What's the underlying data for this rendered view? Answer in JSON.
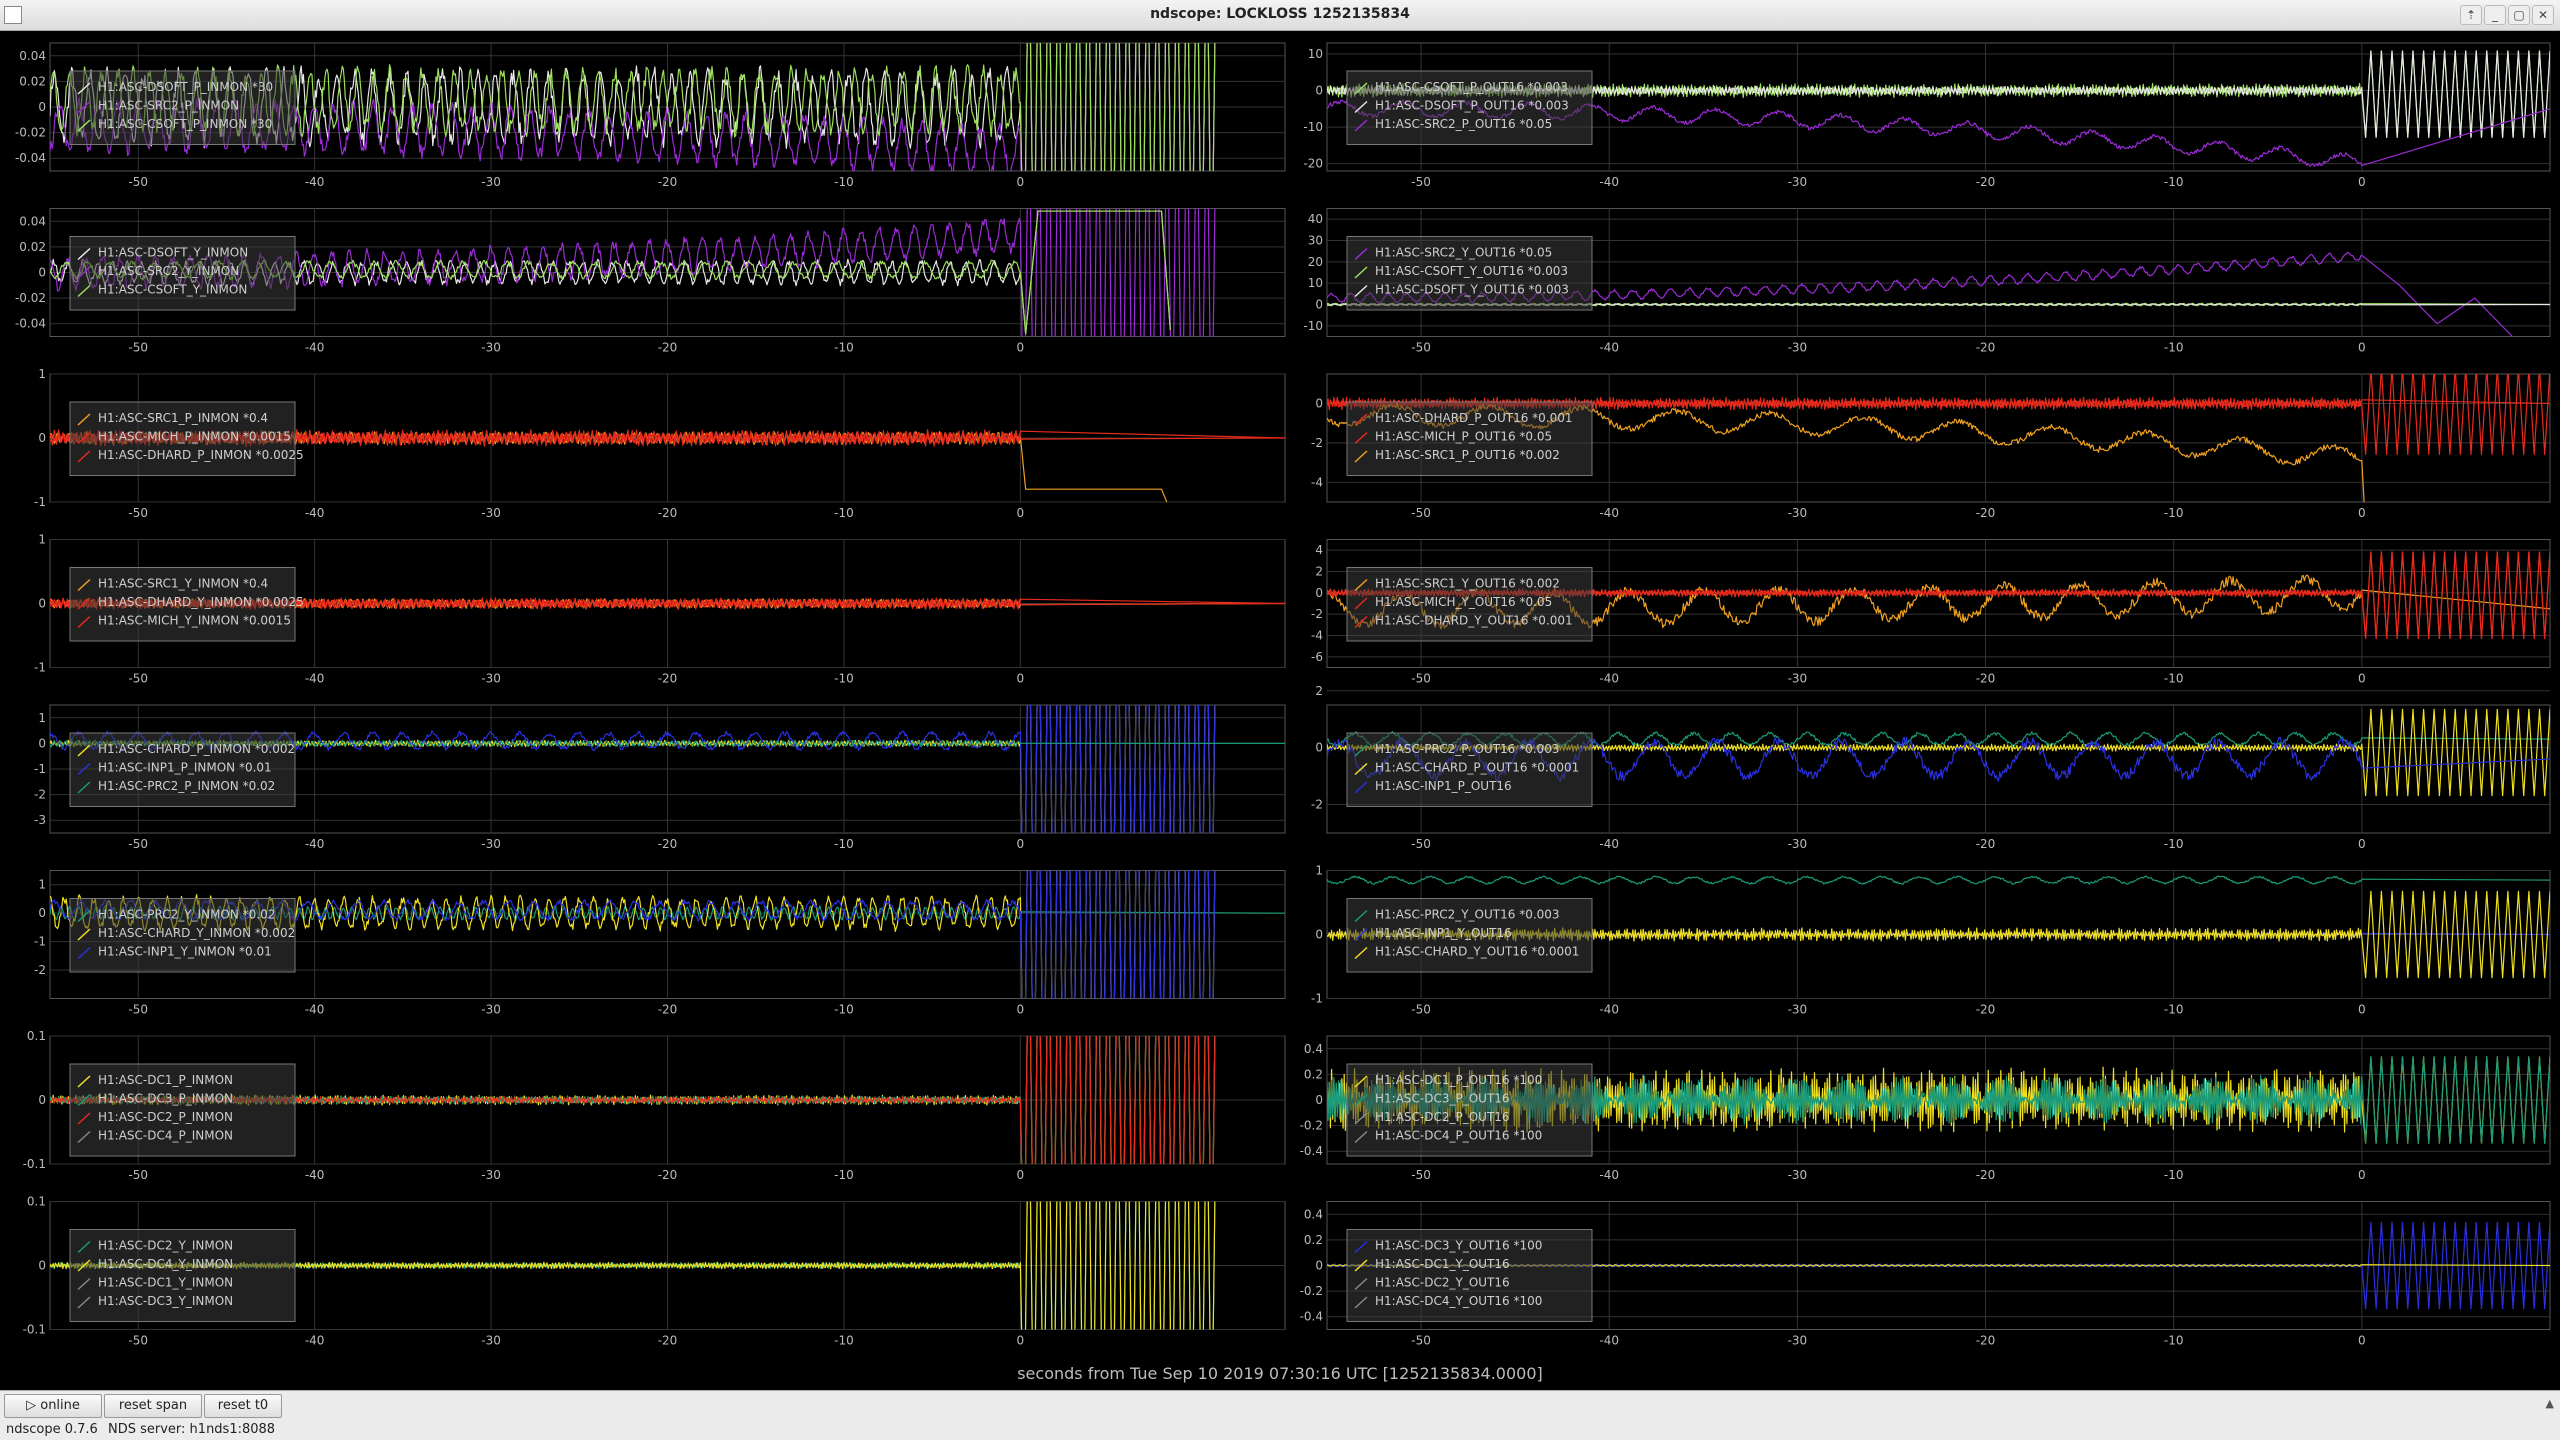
{
  "window": {
    "title": "ndscope: LOCKLOSS 1252135834",
    "controls": [
      "⇡",
      "_",
      "▢",
      "✕"
    ]
  },
  "x_caption": "seconds from Tue Sep 10 2019 07:30:16 UTC [1252135834.0000]",
  "toolbar": {
    "online_label": "online",
    "reset_span_label": "reset span",
    "reset_t0_label": "reset t0"
  },
  "status": {
    "version": "ndscope 0.7.6",
    "server": "NDS server: h1nds1:8088"
  },
  "colors": {
    "background": "#000000",
    "grid": "#333333",
    "axis_text": "#bbbbbb",
    "purple": "#9a2bd6",
    "green": "#9ce05a",
    "white": "#e8e8e8",
    "red": "#e82a1c",
    "orange": "#f0a020",
    "blue": "#2a30e0",
    "yellow": "#f0e020",
    "teal": "#1a9a78"
  },
  "chart_data": [
    {
      "type": "line",
      "xlim": [
        -55,
        15
      ],
      "xticks": [
        -50,
        -40,
        -30,
        -20,
        -10,
        0
      ],
      "ylim": [
        -0.05,
        0.05
      ],
      "yticks": [
        "0.04",
        "0.02",
        "0",
        "-0.02",
        "-0.04"
      ],
      "grid": true,
      "legend_position": "top-left",
      "legend": [
        "H1:ASC-DSOFT_P_INMON *30",
        "H1:ASC-SRC2_P_INMON",
        "H1:ASC-CSOFT_P_INMON *30"
      ],
      "series": [
        {
          "name": "H1:ASC-DSOFT_P_INMON *30",
          "color": "#e8e8e8",
          "base": 0.0,
          "amp": 0.025,
          "freq": 1.0,
          "post": "rail"
        },
        {
          "name": "H1:ASC-SRC2_P_INMON",
          "color": "#9a2bd6",
          "base": -0.015,
          "amp": 0.018,
          "freq": 0.9,
          "drift": -0.02,
          "post": "rail"
        },
        {
          "name": "H1:ASC-CSOFT_P_INMON *30",
          "color": "#9ce05a",
          "base": 0.005,
          "amp": 0.022,
          "freq": 1.1,
          "post": "rail"
        }
      ]
    },
    {
      "type": "line",
      "xlim": [
        -55,
        10
      ],
      "xticks": [
        -50,
        -40,
        -30,
        -20,
        -10,
        0
      ],
      "ylim": [
        -22,
        13
      ],
      "yticks": [
        "10",
        "0",
        "-10",
        "-20"
      ],
      "grid": true,
      "legend_position": "top-left",
      "legend": [
        "H1:ASC-CSOFT_P_OUT16 *0.003",
        "H1:ASC-DSOFT_P_OUT16 *0.003",
        "H1:ASC-SRC2_P_OUT16 *0.05"
      ],
      "series": [
        {
          "name": "H1:ASC-CSOFT_P_OUT16 *0.003",
          "color": "#9ce05a",
          "base": 0.0,
          "amp": 1.5,
          "freq": 6.0,
          "post": "burst"
        },
        {
          "name": "H1:ASC-DSOFT_P_OUT16 *0.003",
          "color": "#e8e8e8",
          "base": 0.0,
          "amp": 1.0,
          "freq": 5.0,
          "post": "burst"
        },
        {
          "name": "H1:ASC-SRC2_P_OUT16 *0.05",
          "color": "#9a2bd6",
          "base": -5,
          "amp": 2,
          "freq": 0.3,
          "drift": -15,
          "post": "flat"
        }
      ]
    },
    {
      "type": "line",
      "xlim": [
        -55,
        15
      ],
      "xticks": [
        -50,
        -40,
        -30,
        -20,
        -10,
        0
      ],
      "ylim": [
        -0.05,
        0.05
      ],
      "yticks": [
        "0.04",
        "0.02",
        "0",
        "-0.02",
        "-0.04"
      ],
      "grid": true,
      "legend_position": "top-left",
      "legend": [
        "H1:ASC-DSOFT_Y_INMON",
        "H1:ASC-SRC2_Y_INMON",
        "H1:ASC-CSOFT_Y_INMON"
      ],
      "series": [
        {
          "name": "H1:ASC-DSOFT_Y_INMON",
          "color": "#e8e8e8",
          "base": 0.0,
          "amp": 0.008,
          "freq": 1.2,
          "post": "box"
        },
        {
          "name": "H1:ASC-SRC2_Y_INMON",
          "color": "#9a2bd6",
          "base": 0.0,
          "amp": 0.012,
          "freq": 1.0,
          "drift": 0.03,
          "post": "rail"
        },
        {
          "name": "H1:ASC-CSOFT_Y_INMON",
          "color": "#9ce05a",
          "base": 0.002,
          "amp": 0.006,
          "freq": 0.8,
          "post": "box"
        }
      ]
    },
    {
      "type": "line",
      "xlim": [
        -55,
        10
      ],
      "xticks": [
        -50,
        -40,
        -30,
        -20,
        -10,
        0
      ],
      "ylim": [
        -15,
        45
      ],
      "yticks": [
        "40",
        "30",
        "20",
        "10",
        "0",
        "-10"
      ],
      "grid": true,
      "legend_position": "top-left",
      "legend": [
        "H1:ASC-SRC2_Y_OUT16 *0.05",
        "H1:ASC-CSOFT_Y_OUT16 *0.003",
        "H1:ASC-DSOFT_Y_OUT16 *0.003"
      ],
      "series": [
        {
          "name": "H1:ASC-SRC2_Y_OUT16 *0.05",
          "color": "#9a2bd6",
          "base": 3,
          "amp": 2,
          "freq": 1.0,
          "drift": 20,
          "post": "dip"
        },
        {
          "name": "H1:ASC-CSOFT_Y_OUT16 *0.003",
          "color": "#9ce05a",
          "base": 0,
          "amp": 0.5,
          "freq": 2,
          "post": "flat"
        },
        {
          "name": "H1:ASC-DSOFT_Y_OUT16 *0.003",
          "color": "#e8e8e8",
          "base": 0,
          "amp": 0.3,
          "freq": 2,
          "post": "flat"
        }
      ]
    },
    {
      "type": "line",
      "xlim": [
        -55,
        15
      ],
      "xticks": [
        -50,
        -40,
        -30,
        -20,
        -10,
        0
      ],
      "ylim": [
        -1,
        1
      ],
      "yticks": [
        "1",
        "0",
        "-1"
      ],
      "grid": true,
      "legend_position": "top-left",
      "legend": [
        "H1:ASC-SRC1_P_INMON *0.4",
        "H1:ASC-MICH_P_INMON *0.0015",
        "H1:ASC-DHARD_P_INMON *0.0025"
      ],
      "series": [
        {
          "name": "H1:ASC-SRC1_P_INMON *0.4",
          "color": "#f0a020",
          "base": 0,
          "amp": 0.08,
          "freq": 3,
          "post": "step"
        },
        {
          "name": "H1:ASC-MICH_P_INMON *0.0015",
          "color": "#e82a1c",
          "base": 0,
          "amp": 0.1,
          "freq": 4,
          "post": "flat"
        },
        {
          "name": "H1:ASC-DHARD_P_INMON *0.0025",
          "color": "#e82a1c",
          "base": 0,
          "amp": 0.06,
          "freq": 5,
          "post": "flat"
        }
      ]
    },
    {
      "type": "line",
      "xlim": [
        -55,
        10
      ],
      "xticks": [
        -50,
        -40,
        -30,
        -20,
        -10,
        0
      ],
      "ylim": [
        -5,
        1.5
      ],
      "yticks": [
        "0",
        "-2",
        "-4"
      ],
      "grid": true,
      "legend_position": "top-left",
      "legend": [
        "H1:ASC-DHARD_P_OUT16 *0.001",
        "H1:ASC-MICH_P_OUT16 *0.05",
        "H1:ASC-SRC1_P_OUT16 *0.002"
      ],
      "series": [
        {
          "name": "H1:ASC-DHARD_P_OUT16 *0.001",
          "color": "#e82a1c",
          "base": 0,
          "amp": 0.25,
          "freq": 6,
          "post": "burst"
        },
        {
          "name": "H1:ASC-MICH_P_OUT16 *0.05",
          "color": "#e82a1c",
          "base": 0,
          "amp": 0.15,
          "freq": 5,
          "post": "flat"
        },
        {
          "name": "H1:ASC-SRC1_P_OUT16 *0.002",
          "color": "#f0a020",
          "base": -0.6,
          "amp": 0.5,
          "freq": 0.2,
          "drift": -2.2,
          "post": "drop"
        }
      ]
    },
    {
      "type": "line",
      "xlim": [
        -55,
        15
      ],
      "xticks": [
        -50,
        -40,
        -30,
        -20,
        -10,
        0
      ],
      "ylim": [
        -1,
        1
      ],
      "yticks": [
        "1",
        "0",
        "-1"
      ],
      "grid": true,
      "legend_position": "top-left",
      "legend": [
        "H1:ASC-SRC1_Y_INMON *0.4",
        "H1:ASC-DHARD_Y_INMON *0.0025",
        "H1:ASC-MICH_Y_INMON *0.0015"
      ],
      "series": [
        {
          "name": "H1:ASC-SRC1_Y_INMON *0.4",
          "color": "#f0a020",
          "base": 0,
          "amp": 0.06,
          "freq": 3,
          "post": "flat"
        },
        {
          "name": "H1:ASC-DHARD_Y_INMON *0.0025",
          "color": "#e82a1c",
          "base": 0,
          "amp": 0.07,
          "freq": 4,
          "post": "flat"
        },
        {
          "name": "H1:ASC-MICH_Y_INMON *0.0015",
          "color": "#e82a1c",
          "base": 0,
          "amp": 0.05,
          "freq": 5,
          "post": "flat"
        }
      ]
    },
    {
      "type": "line",
      "xlim": [
        -55,
        10
      ],
      "xticks": [
        -50,
        -40,
        -30,
        -20,
        -10,
        0
      ],
      "ylim": [
        -7,
        5
      ],
      "yticks": [
        "4",
        "2",
        "0",
        "-2",
        "-4",
        "-6"
      ],
      "grid": true,
      "legend_position": "top-left",
      "legend": [
        "H1:ASC-SRC1_Y_OUT16 *0.002",
        "H1:ASC-MICH_Y_OUT16 *0.05",
        "H1:ASC-DHARD_Y_OUT16 *0.001"
      ],
      "series": [
        {
          "name": "H1:ASC-SRC1_Y_OUT16 *0.002",
          "color": "#f0a020",
          "base": -1.5,
          "amp": 1.5,
          "freq": 0.25,
          "drift": 1.5,
          "post": "flat"
        },
        {
          "name": "H1:ASC-MICH_Y_OUT16 *0.05",
          "color": "#e82a1c",
          "base": 0,
          "amp": 0.3,
          "freq": 5,
          "post": "burst"
        },
        {
          "name": "H1:ASC-DHARD_Y_OUT16 *0.001",
          "color": "#e82a1c",
          "base": 0,
          "amp": 0.2,
          "freq": 6,
          "post": "burst"
        }
      ]
    },
    {
      "type": "line",
      "xlim": [
        -55,
        15
      ],
      "xticks": [
        -50,
        -40,
        -30,
        -20,
        -10,
        0
      ],
      "ylim": [
        -3.5,
        1.5
      ],
      "yticks": [
        "1",
        "0",
        "-1",
        "-2",
        "-3"
      ],
      "grid": true,
      "legend_position": "top-left",
      "legend": [
        "H1:ASC-CHARD_P_INMON *0.002",
        "H1:ASC-INP1_P_INMON *0.01",
        "H1:ASC-PRC2_P_INMON *0.02"
      ],
      "series": [
        {
          "name": "H1:ASC-CHARD_P_INMON *0.002",
          "color": "#f0e020",
          "base": 0,
          "amp": 0.1,
          "freq": 5,
          "post": "rail"
        },
        {
          "name": "H1:ASC-INP1_P_INMON *0.01",
          "color": "#2a30e0",
          "base": 0.1,
          "amp": 0.3,
          "freq": 0.6,
          "post": "rail"
        },
        {
          "name": "H1:ASC-PRC2_P_INMON *0.02",
          "color": "#1a9a78",
          "base": 0,
          "amp": 0.1,
          "freq": 3,
          "post": "flat"
        }
      ]
    },
    {
      "type": "line",
      "xlim": [
        -55,
        10
      ],
      "xticks": [
        -50,
        -40,
        -30,
        -20,
        -10,
        0
      ],
      "ylim": [
        -3,
        1.5
      ],
      "yticks": [
        "2",
        "0",
        "-2"
      ],
      "grid": true,
      "legend_position": "top-left",
      "legend": [
        "H1:ASC-PRC2_P_OUT16 *0.003",
        "H1:ASC-CHARD_P_OUT16 *0.0001",
        "H1:ASC-INP1_P_OUT16"
      ],
      "series": [
        {
          "name": "H1:ASC-PRC2_P_OUT16 *0.003",
          "color": "#1a9a78",
          "base": 0.3,
          "amp": 0.2,
          "freq": 0.5,
          "post": "flat"
        },
        {
          "name": "H1:ASC-CHARD_P_OUT16 *0.0001",
          "color": "#f0e020",
          "base": 0,
          "amp": 0.1,
          "freq": 6,
          "post": "burst"
        },
        {
          "name": "H1:ASC-INP1_P_OUT16",
          "color": "#2a30e0",
          "base": -0.4,
          "amp": 0.6,
          "freq": 0.3,
          "post": "flat"
        }
      ]
    },
    {
      "type": "line",
      "xlim": [
        -55,
        15
      ],
      "xticks": [
        -50,
        -40,
        -30,
        -20,
        -10,
        0
      ],
      "ylim": [
        -3,
        1.5
      ],
      "yticks": [
        "1",
        "0",
        "-1",
        "-2"
      ],
      "grid": true,
      "legend_position": "top-left",
      "legend": [
        "H1:ASC-PRC2_Y_INMON *0.02",
        "H1:ASC-CHARD_Y_INMON *0.002",
        "H1:ASC-INP1_Y_INMON *0.01"
      ],
      "series": [
        {
          "name": "H1:ASC-PRC2_Y_INMON *0.02",
          "color": "#1a9a78",
          "base": 0,
          "amp": 0.2,
          "freq": 2,
          "post": "flat"
        },
        {
          "name": "H1:ASC-CHARD_Y_INMON *0.002",
          "color": "#f0e020",
          "base": 0,
          "amp": 0.5,
          "freq": 1.2,
          "post": "rail"
        },
        {
          "name": "H1:ASC-INP1_Y_INMON *0.01",
          "color": "#2a30e0",
          "base": 0.1,
          "amp": 0.3,
          "freq": 0.7,
          "post": "rail"
        }
      ]
    },
    {
      "type": "line",
      "xlim": [
        -55,
        10
      ],
      "xticks": [
        -50,
        -40,
        -30,
        -20,
        -10,
        0
      ],
      "ylim": [
        -1,
        1
      ],
      "yticks": [
        "1",
        "0",
        "-1"
      ],
      "grid": true,
      "legend_position": "top-left",
      "legend": [
        "H1:ASC-PRC2_Y_OUT16 *0.003",
        "H1:ASC-INP1_Y_OUT16",
        "H1:ASC-CHARD_Y_OUT16 *0.0001"
      ],
      "series": [
        {
          "name": "H1:ASC-PRC2_Y_OUT16 *0.003",
          "color": "#1a9a78",
          "base": 0.85,
          "amp": 0.05,
          "freq": 0.5,
          "post": "flat"
        },
        {
          "name": "H1:ASC-INP1_Y_OUT16",
          "color": "#2a30e0",
          "base": 0,
          "amp": 0.02,
          "freq": 1,
          "post": "flat"
        },
        {
          "name": "H1:ASC-CHARD_Y_OUT16 *0.0001",
          "color": "#f0e020",
          "base": 0,
          "amp": 0.08,
          "freq": 7,
          "post": "burst"
        }
      ]
    },
    {
      "type": "line",
      "xlim": [
        -55,
        15
      ],
      "xticks": [
        -50,
        -40,
        -30,
        -20,
        -10,
        0
      ],
      "ylim": [
        -0.1,
        0.1
      ],
      "yticks": [
        "0.1",
        "0",
        "-0.1"
      ],
      "grid": true,
      "legend_position": "top-left",
      "legend": [
        "H1:ASC-DC1_P_INMON",
        "H1:ASC-DC3_P_INMON",
        "H1:ASC-DC2_P_INMON",
        "H1:ASC-DC4_P_INMON"
      ],
      "series": [
        {
          "name": "H1:ASC-DC1_P_INMON",
          "color": "#f0e020",
          "base": 0,
          "amp": 0.006,
          "freq": 7,
          "post": "rail"
        },
        {
          "name": "H1:ASC-DC3_P_INMON",
          "color": "#1a9a78",
          "base": 0,
          "amp": 0.005,
          "freq": 6,
          "post": "rail"
        },
        {
          "name": "H1:ASC-DC2_P_INMON",
          "color": "#e82a1c",
          "base": 0,
          "amp": 0.004,
          "freq": 5,
          "post": "rail"
        }
      ]
    },
    {
      "type": "line",
      "xlim": [
        -55,
        10
      ],
      "xticks": [
        -50,
        -40,
        -30,
        -20,
        -10,
        0
      ],
      "ylim": [
        -0.5,
        0.5
      ],
      "yticks": [
        "0.4",
        "0.2",
        "0",
        "-0.2",
        "-0.4"
      ],
      "grid": true,
      "legend_position": "top-left",
      "legend": [
        "H1:ASC-DC1_P_OUT16 *100",
        "H1:ASC-DC3_P_OUT16",
        "H1:ASC-DC2_P_OUT16",
        "H1:ASC-DC4_P_OUT16 *100"
      ],
      "series": [
        {
          "name": "H1:ASC-DC1_P_OUT16 *100",
          "color": "#f0e020",
          "base": 0,
          "amp": 0.2,
          "freq": 9,
          "post": "burst"
        },
        {
          "name": "H1:ASC-DC3_P_OUT16",
          "color": "#1a9a78",
          "base": 0,
          "amp": 0.15,
          "freq": 8,
          "post": "burst"
        }
      ]
    },
    {
      "type": "line",
      "xlim": [
        -55,
        15
      ],
      "xticks": [
        -50,
        -40,
        -30,
        -20,
        -10,
        0
      ],
      "ylim": [
        -0.1,
        0.1
      ],
      "yticks": [
        "0.1",
        "0",
        "-0.1"
      ],
      "grid": true,
      "legend_position": "top-left",
      "legend": [
        "H1:ASC-DC2_Y_INMON",
        "H1:ASC-DC4_Y_INMON",
        "H1:ASC-DC1_Y_INMON",
        "H1:ASC-DC3_Y_INMON"
      ],
      "series": [
        {
          "name": "H1:ASC-DC2_Y_INMON",
          "color": "#1a9a78",
          "base": 0,
          "amp": 0.004,
          "freq": 7,
          "post": "rail"
        },
        {
          "name": "H1:ASC-DC1_Y_INMON",
          "color": "#f0e020",
          "base": 0,
          "amp": 0.004,
          "freq": 6,
          "post": "rail"
        }
      ]
    },
    {
      "type": "line",
      "xlim": [
        -55,
        10
      ],
      "xticks": [
        -50,
        -40,
        -30,
        -20,
        -10,
        0
      ],
      "ylim": [
        -0.5,
        0.5
      ],
      "yticks": [
        "0.4",
        "0.2",
        "0",
        "-0.2",
        "-0.4"
      ],
      "grid": true,
      "legend_position": "top-left",
      "legend": [
        "H1:ASC-DC3_Y_OUT16 *100",
        "H1:ASC-DC1_Y_OUT16",
        "H1:ASC-DC2_Y_OUT16",
        "H1:ASC-DC4_Y_OUT16 *100"
      ],
      "series": [
        {
          "name": "H1:ASC-DC3_Y_OUT16 *100",
          "color": "#2a30e0",
          "base": 0,
          "amp": 0.01,
          "freq": 3,
          "post": "burst"
        },
        {
          "name": "H1:ASC-DC1_Y_OUT16",
          "color": "#f0e020",
          "base": 0,
          "amp": 0.005,
          "freq": 3,
          "post": "flat"
        }
      ]
    }
  ]
}
